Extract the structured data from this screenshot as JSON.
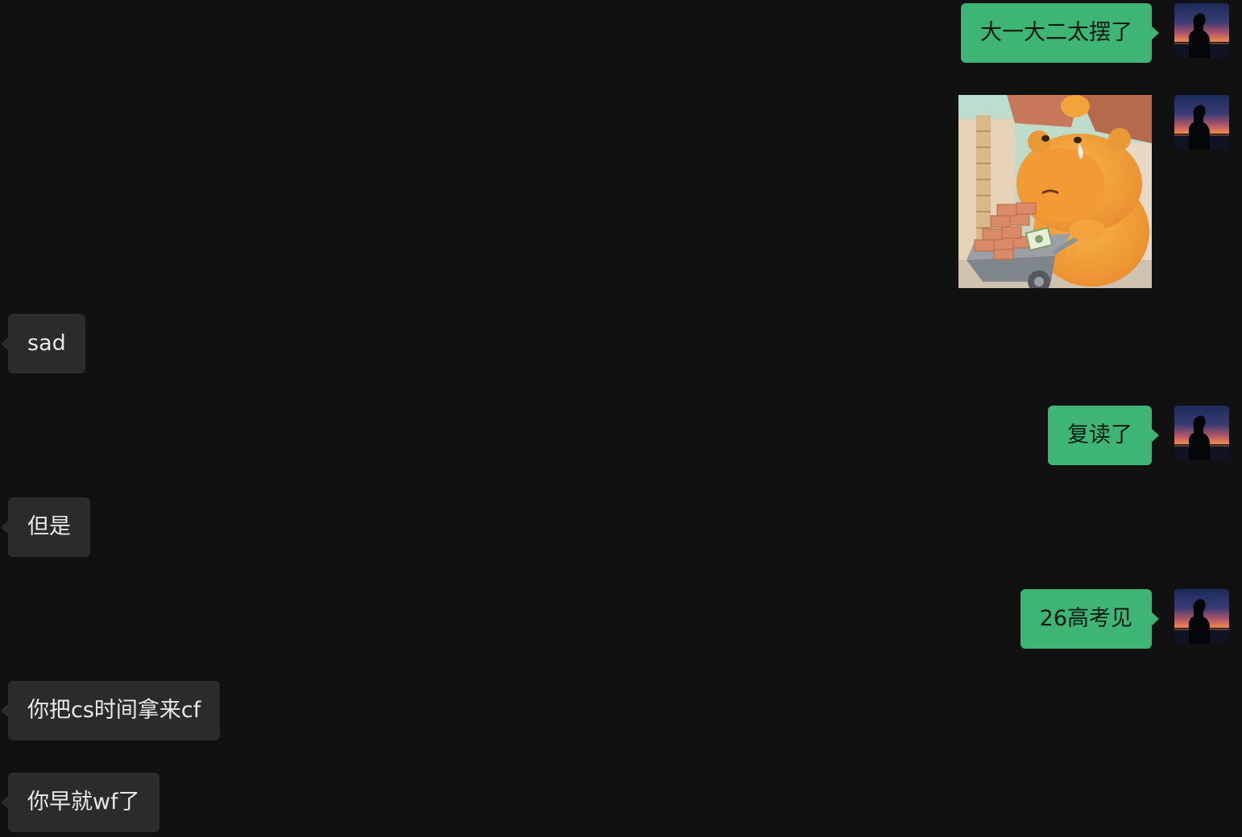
{
  "messages": [
    {
      "sender": "self",
      "type": "text",
      "text": "大一大二太摆了"
    },
    {
      "sender": "self",
      "type": "sticker",
      "sticker": "crying-orange-bear-pushing-brick-wheelbarrow"
    },
    {
      "sender": "other",
      "type": "text",
      "text": "sad"
    },
    {
      "sender": "self",
      "type": "text",
      "text": "复读了"
    },
    {
      "sender": "other",
      "type": "text",
      "text": "但是"
    },
    {
      "sender": "self",
      "type": "text",
      "text": "26高考见"
    },
    {
      "sender": "other",
      "type": "text",
      "text": "你把cs时间拿来cf"
    },
    {
      "sender": "other",
      "type": "text",
      "text": "你早就wf了"
    }
  ],
  "colors": {
    "background": "#111111",
    "outgoing_bubble": "#3eb575",
    "incoming_bubble": "#2b2b2b",
    "outgoing_text": "#0d1a12",
    "incoming_text": "#e9e9e9"
  },
  "avatar": {
    "icon": "sunset-silhouette-avatar"
  }
}
